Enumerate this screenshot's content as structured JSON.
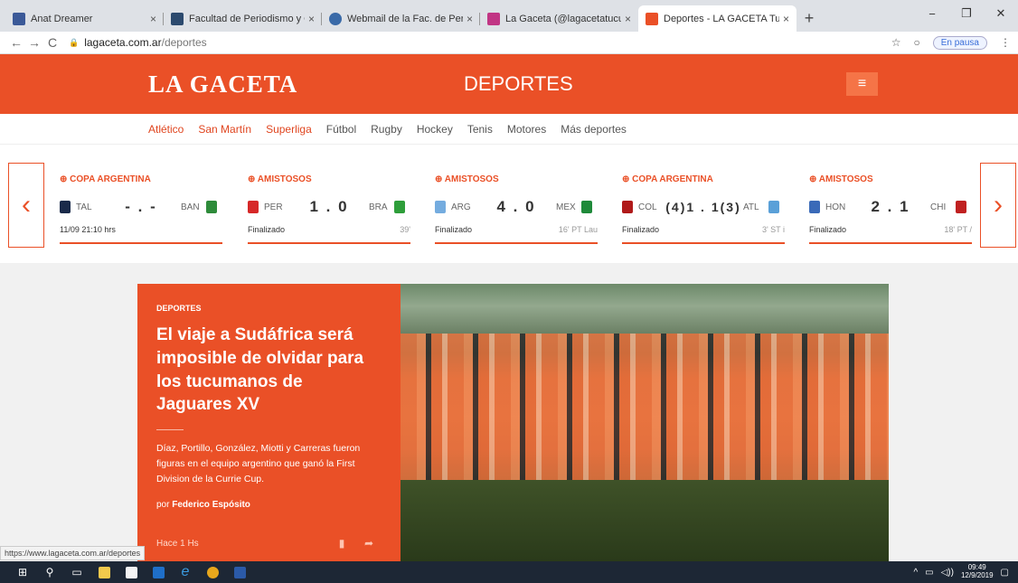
{
  "browser": {
    "tabs": [
      {
        "title": "Anat Dreamer",
        "color": "#3b5998"
      },
      {
        "title": "Facultad de Periodismo y Comun",
        "color": "#2c4a6e"
      },
      {
        "title": "Webmail de la Fac. de Periodism",
        "color": "#3a6aa8"
      },
      {
        "title": "La Gaceta (@lagacetatucuman) ·",
        "color": "#c13584"
      },
      {
        "title": "Deportes - LA GACETA Tucumán",
        "color": "#ea5027"
      }
    ],
    "url_host": "lagaceta.com.ar",
    "url_path": "/deportes",
    "paused_label": "En pausa",
    "status_url": "https://www.lagaceta.com.ar/deportes"
  },
  "header": {
    "logo": "LA GACETA",
    "section": "DEPORTES"
  },
  "subnav": [
    "Atlético",
    "San Martín",
    "Superliga",
    "Fútbol",
    "Rugby",
    "Hockey",
    "Tenis",
    "Motores",
    "Más deportes"
  ],
  "scores": [
    {
      "competition": "COPA ARGENTINA",
      "home": "TAL",
      "score": "- . -",
      "away": "BAN",
      "status": "11/09 21:10 hrs",
      "minute": "",
      "home_color": "#1a2a4a",
      "away_color": "#2e8b3a"
    },
    {
      "competition": "AMISTOSOS",
      "home": "PER",
      "score": "1 . 0",
      "away": "BRA",
      "status": "Finalizado",
      "minute": "39'",
      "home_color": "#d62828",
      "away_color": "#2e9e3a"
    },
    {
      "competition": "AMISTOSOS",
      "home": "ARG",
      "score": "4 . 0",
      "away": "MEX",
      "status": "Finalizado",
      "minute": "16' PT Lau",
      "home_color": "#74acdf",
      "away_color": "#1f8a3a"
    },
    {
      "competition": "COPA ARGENTINA",
      "home": "COL",
      "score": "(4)1 . 1(3)",
      "away": "ATL",
      "status": "Finalizado",
      "minute": "3' ST i",
      "home_color": "#b01a1a",
      "away_color": "#5aa0d8"
    },
    {
      "competition": "AMISTOSOS",
      "home": "HON",
      "score": "2 . 1",
      "away": "CHI",
      "status": "Finalizado",
      "minute": "18' PT /",
      "home_color": "#3a6ab8",
      "away_color": "#c02020"
    }
  ],
  "story": {
    "kicker": "DEPORTES",
    "headline": "El viaje a Sudáfrica será imposible de olvidar para los tucumanos de Jaguares XV",
    "lead": "Díaz, Portillo, González, Miotti y Carreras fueron figuras en el equipo argentino que ganó la First Division de la Currie Cup.",
    "byline_prefix": "por",
    "author": "Federico Espósito",
    "time": "Hace 1 Hs"
  },
  "taskbar": {
    "time": "09:49",
    "date": "12/9/2019"
  }
}
